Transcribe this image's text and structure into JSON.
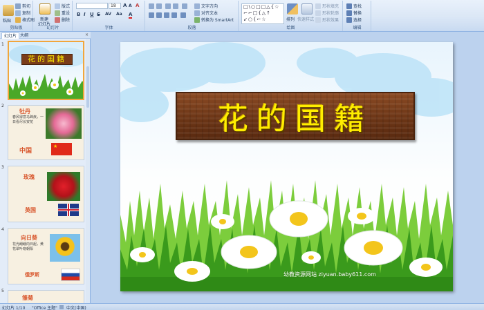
{
  "ribbon": {
    "clipboard": {
      "paste": "粘贴",
      "cut": "剪切",
      "copy": "复制",
      "format_painter": "格式刷",
      "label": "剪贴板"
    },
    "slides": {
      "new_slide": "新建",
      "new_slide2": "幻灯片",
      "layout": "版式",
      "reset": "重设",
      "delete": "删除",
      "label": "幻灯片"
    },
    "font": {
      "font_name": "",
      "font_size": "18",
      "label": "字体",
      "grow": "A",
      "shrink": "A",
      "clear": "A",
      "bold": "B",
      "italic": "I",
      "underline": "U",
      "strike": "S",
      "spacing": "AV",
      "case": "Aa",
      "color": "A"
    },
    "paragraph": {
      "text_direction": "文字方向",
      "align_text": "对齐文本",
      "smartart": "转换为 SmartArt",
      "label": "段落"
    },
    "drawing": {
      "shapes": "□\\○□□△{☆\n⌐⌐□{△↑\n↙○{⌐☆",
      "arrange": "排列",
      "quick_styles": "快速样式",
      "fill": "形状填充",
      "outline": "形状轮廓",
      "effects": "形状效果",
      "label": "绘图"
    },
    "editing": {
      "find": "查找",
      "replace": "替换",
      "select": "选择",
      "label": "编辑"
    }
  },
  "left_panel": {
    "tabs": [
      "幻灯片",
      "大纲"
    ],
    "close": "×",
    "slides": [
      {
        "num": "1",
        "title": "花的国籍"
      },
      {
        "num": "2",
        "title": "牡丹",
        "text": "春风得意马蹄疾，一日看尽长安花",
        "country": "中国"
      },
      {
        "num": "3",
        "title": "玫瑰",
        "country": "英国"
      },
      {
        "num": "4",
        "title": "向日葵",
        "text": "花光翩翩向日起，黄花翠叶晓朝阳",
        "country": "俄罗斯"
      },
      {
        "num": "5",
        "title": "雏菊"
      }
    ]
  },
  "slide": {
    "title": "花的国籍",
    "watermark": "幼教资源网站 ziyuan.baby611.com"
  },
  "statusbar": {
    "slide_count": "幻灯片 1/10",
    "theme": "\"Office 主题\"",
    "language": "中文(中国)"
  },
  "colors": {
    "title_yellow": "#ffee00",
    "board_brown": "#6a3415",
    "grass_green": "#3a9a1c",
    "selection_orange": "#f2a63c"
  }
}
